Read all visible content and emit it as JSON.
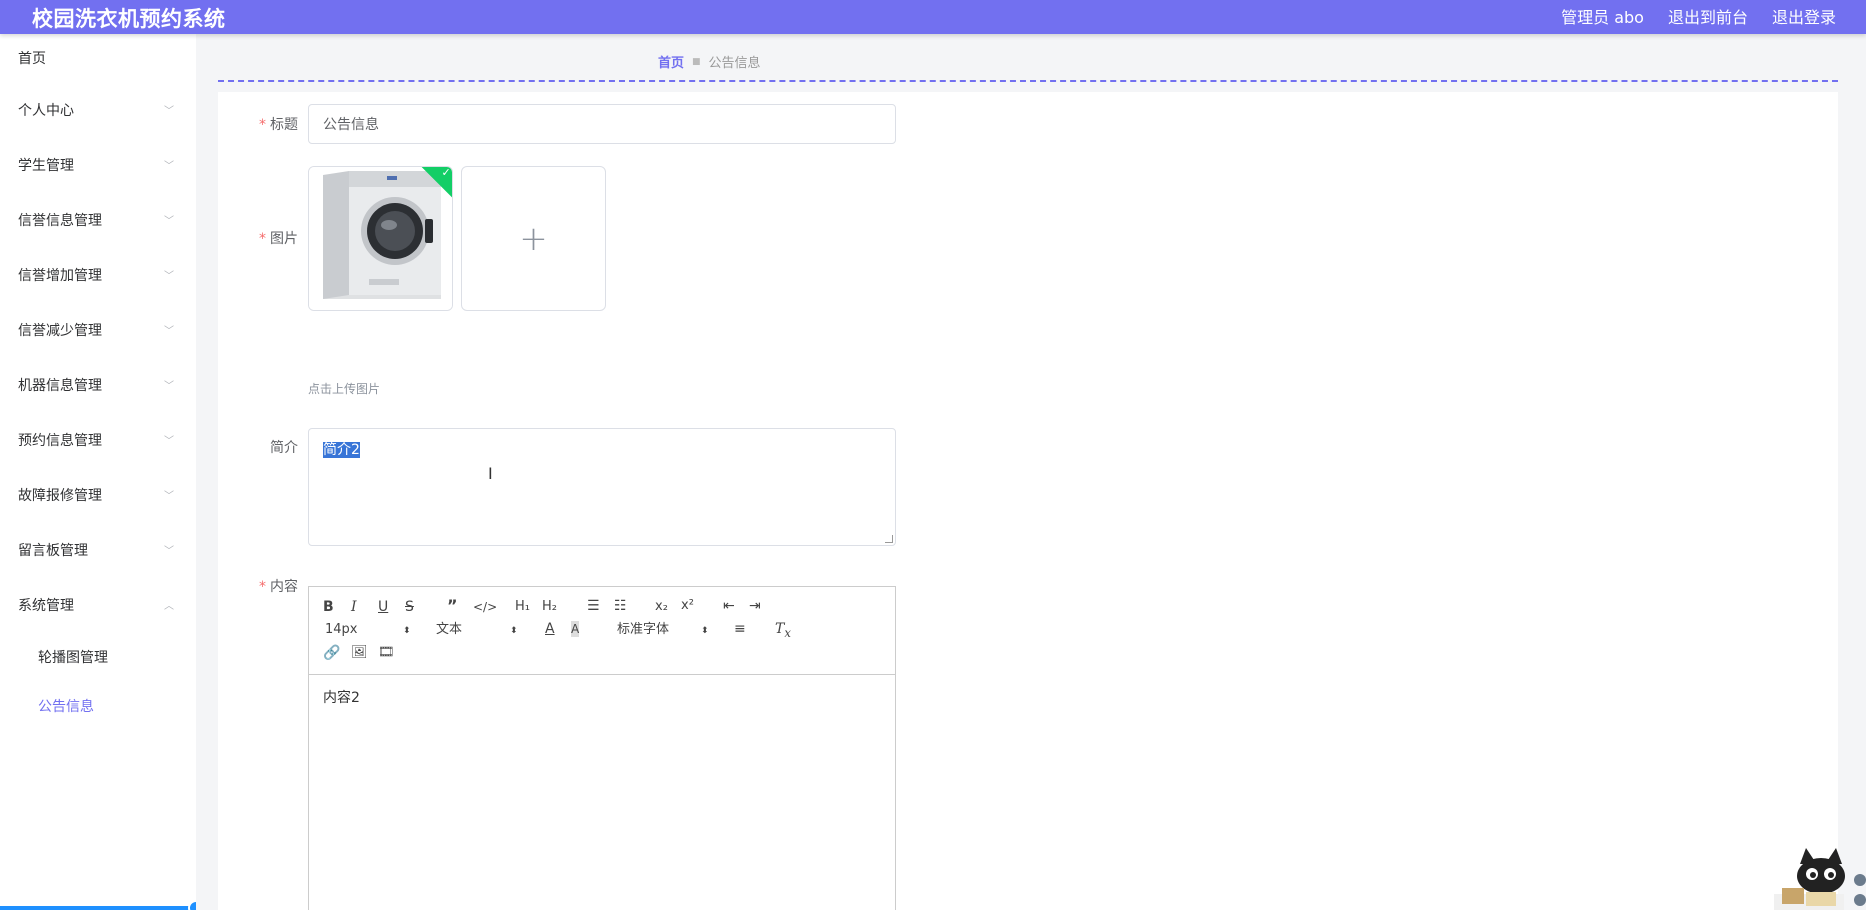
{
  "header": {
    "title": "校园洗衣机预约系统",
    "user": "管理员 abo",
    "to_front": "退出到前台",
    "logout": "退出登录"
  },
  "sidebar": {
    "items": [
      {
        "label": "首页"
      },
      {
        "label": "个人中心"
      },
      {
        "label": "学生管理"
      },
      {
        "label": "信誉信息管理"
      },
      {
        "label": "信誉增加管理"
      },
      {
        "label": "信誉减少管理"
      },
      {
        "label": "机器信息管理"
      },
      {
        "label": "预约信息管理"
      },
      {
        "label": "故障报修管理"
      },
      {
        "label": "留言板管理"
      },
      {
        "label": "系统管理"
      }
    ],
    "sub_items": [
      {
        "label": "轮播图管理"
      },
      {
        "label": "公告信息"
      }
    ]
  },
  "breadcrumb": {
    "home": "首页",
    "current": "公告信息"
  },
  "form": {
    "title_label": "标题",
    "title_value": "公告信息",
    "image_label": "图片",
    "upload_hint": "点击上传图片",
    "intro_label": "简介",
    "intro_value": "简介2",
    "content_label": "内容",
    "content_value": "内容2"
  },
  "editor": {
    "size_select": "14px",
    "header_select": "文本",
    "font_select": "标准字体"
  },
  "colors": {
    "accent": "#7270f0",
    "success": "#13ce66",
    "required": "#f56c6c"
  }
}
